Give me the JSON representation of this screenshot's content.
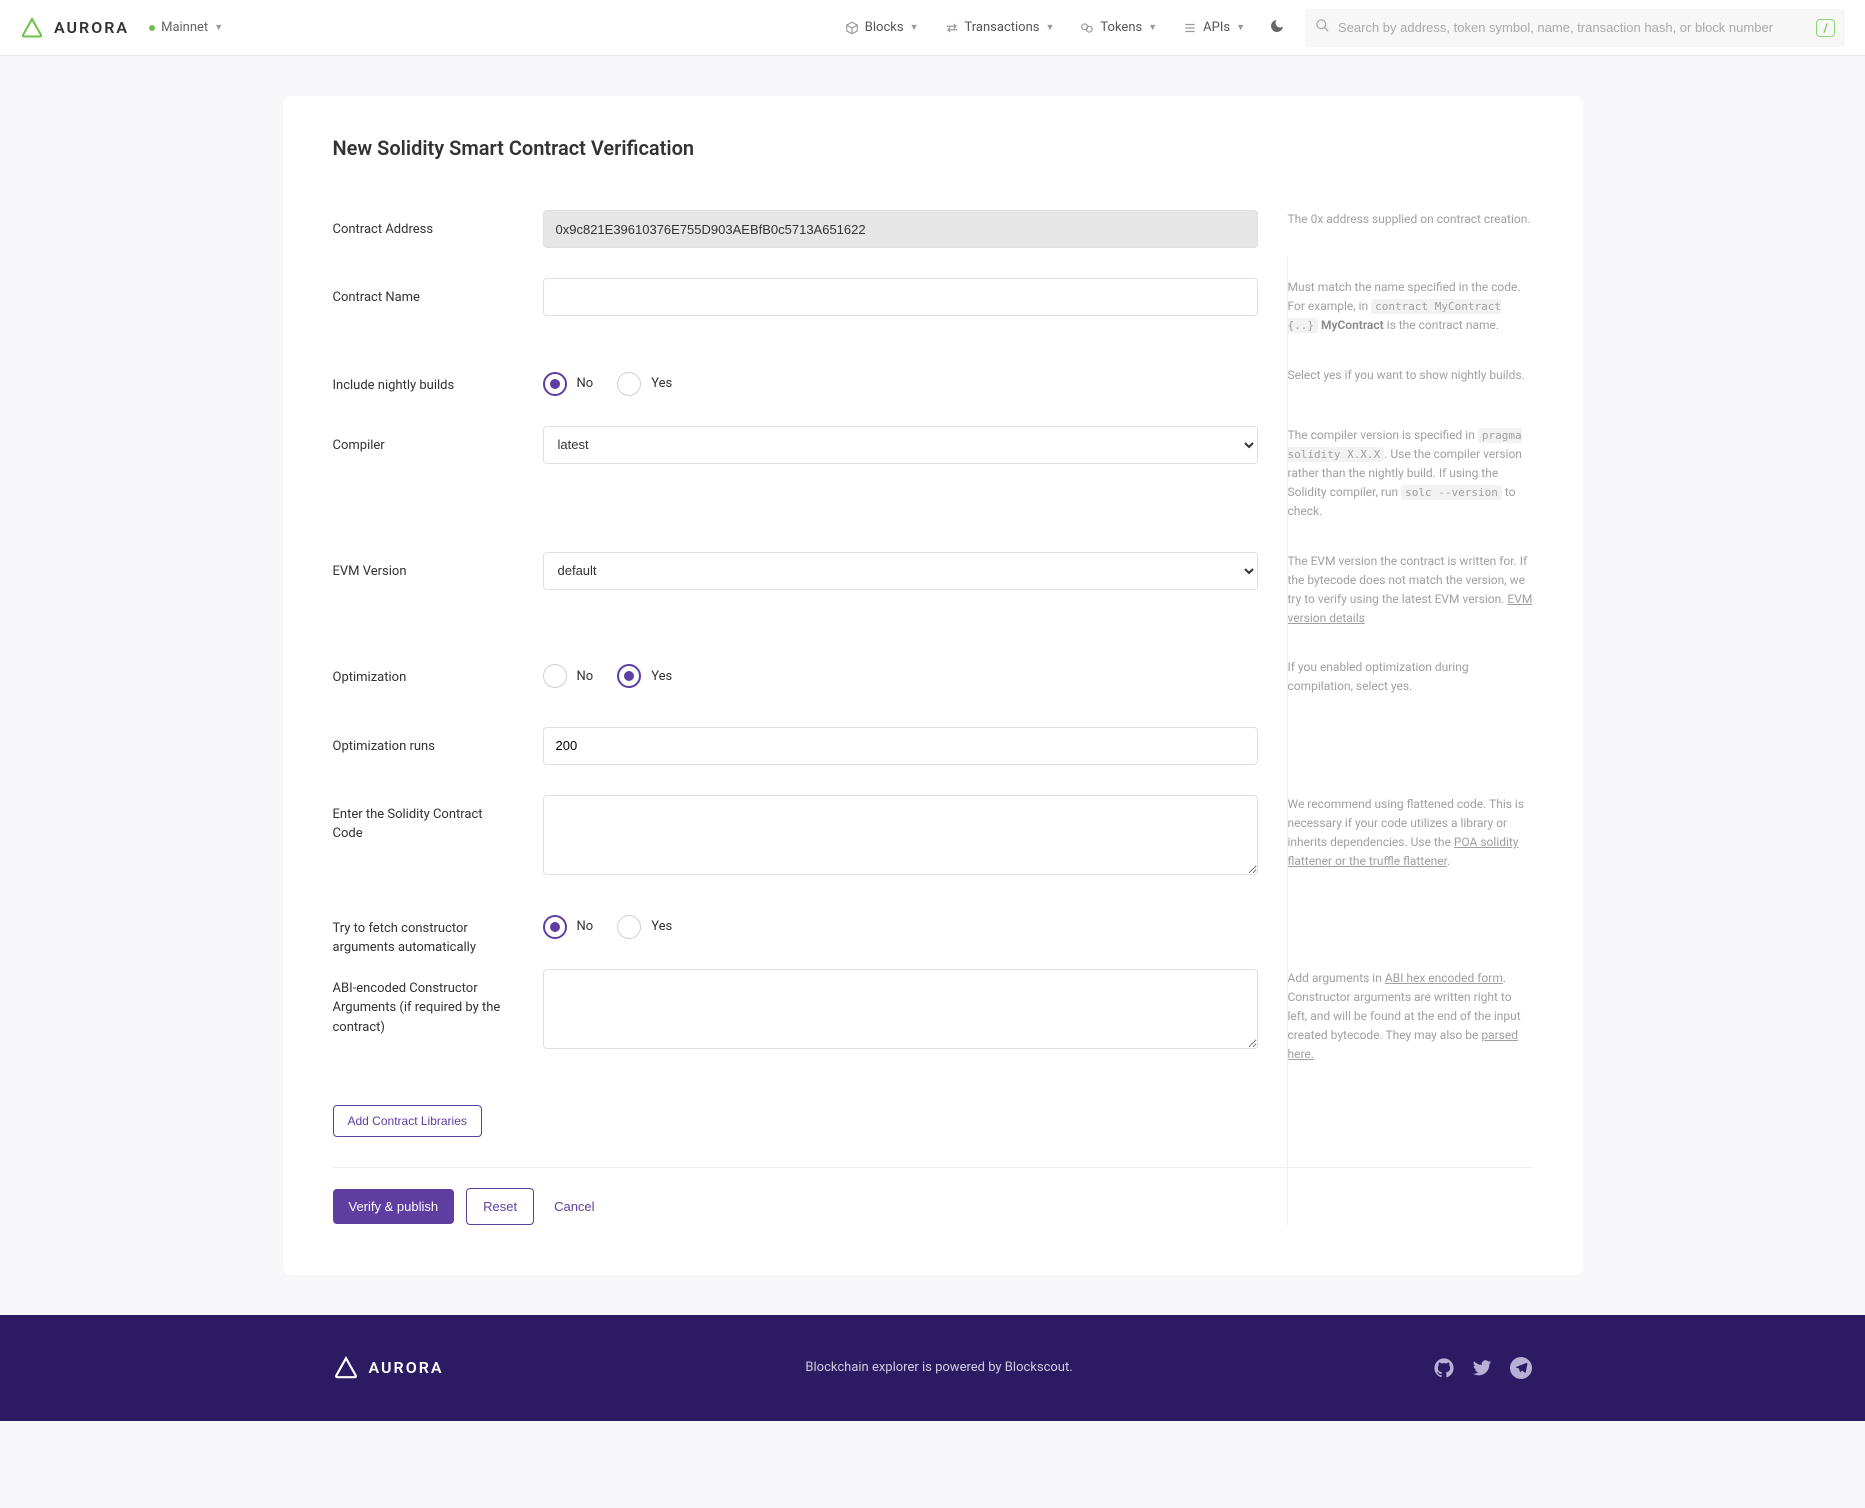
{
  "header": {
    "network": "Mainnet",
    "nav": {
      "blocks": "Blocks",
      "transactions": "Transactions",
      "tokens": "Tokens",
      "apis": "APIs"
    },
    "search_placeholder": "Search by address, token symbol, name, transaction hash, or block number",
    "slash": "/"
  },
  "page": {
    "title": "New Solidity Smart Contract Verification"
  },
  "labels": {
    "contract_address": "Contract Address",
    "contract_name": "Contract Name",
    "nightly": "Include nightly builds",
    "compiler": "Compiler",
    "evm": "EVM Version",
    "optimization": "Optimization",
    "opt_runs": "Optimization runs",
    "code": "Enter the Solidity Contract Code",
    "fetch_args": "Try to fetch constructor arguments automatically",
    "abi_args": "ABI-encoded Constructor Arguments (if required by the contract)",
    "no": "No",
    "yes": "Yes"
  },
  "values": {
    "contract_address": "0x9c821E39610376E755D903AEBfB0c5713A651622",
    "contract_name": "",
    "compiler": "latest",
    "evm": "default",
    "opt_runs": "200",
    "code": "",
    "abi_args": ""
  },
  "help": {
    "address": "The 0x address supplied on contract creation.",
    "name_1": "Must match the name specified in the code. For example, in ",
    "name_code": "contract MyContract {..}",
    "name_strong": "MyContract",
    "name_2": " is the contract name.",
    "nightly": "Select yes if you want to show nightly builds.",
    "compiler_1": "The compiler version is specified in ",
    "compiler_code1": "pragma solidity X.X.X",
    "compiler_2": ". Use the compiler version rather than the nightly build. If using the Solidity compiler, run ",
    "compiler_code2": "solc --version",
    "compiler_3": " to check.",
    "evm_1": "The EVM version the contract is written for. If the bytecode does not match the version, we try to verify using the latest EVM version. ",
    "evm_link": "EVM version details",
    "optimization": "If you enabled optimization during compilation, select yes.",
    "code_1": "We recommend using flattened code. This is necessary if your code utilizes a library or inherits dependencies. Use the ",
    "code_link": "POA solidity flattener or the truffle flattener",
    "abi_1": "Add arguments in ",
    "abi_link1": "ABI hex encoded form",
    "abi_2": ". Constructor arguments are written right to left, and will be found at the end of the input created bytecode. They may also be ",
    "abi_link2": "parsed here."
  },
  "buttons": {
    "add_lib": "Add Contract Libraries",
    "verify": "Verify & publish",
    "reset": "Reset",
    "cancel": "Cancel"
  },
  "footer": {
    "text": "Blockchain explorer is powered by Blockscout."
  }
}
